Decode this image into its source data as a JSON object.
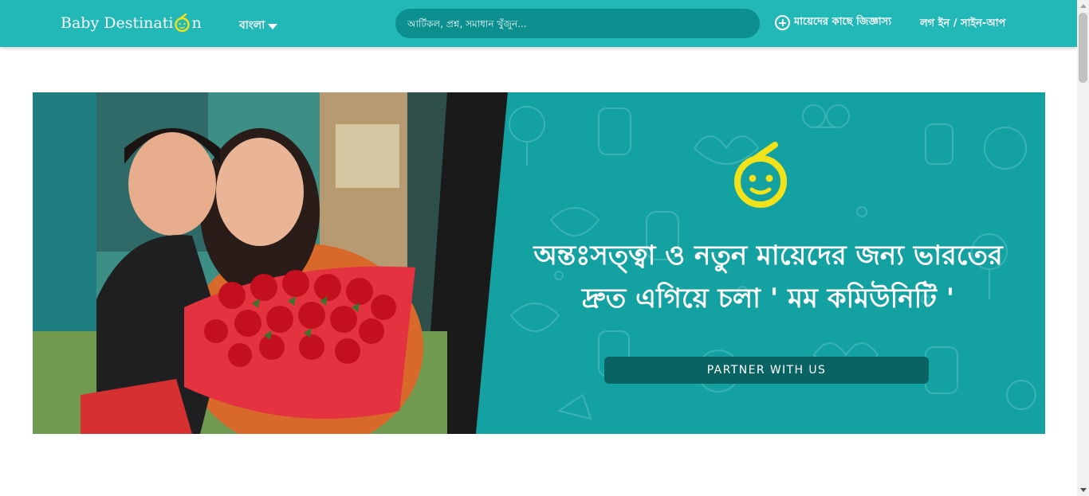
{
  "header": {
    "logo_text_prefix": "Baby Destinati",
    "logo_text_suffix": "n",
    "logo_icon": "baby-face-icon",
    "language_label": "বাংলা",
    "search_placeholder": "আর্টিকল, প্রশ্ন, সমাধান খুঁজুন...",
    "ask_label": "মায়েদের কাছে জিজ্ঞাস্য",
    "login_label": "লগ ইন / সাইন-আপ"
  },
  "banner": {
    "headline_line1": "অন্তঃসত্ত্বা ও নতুন মায়েদের জন্য ভারতের",
    "headline_line2": "দ্রুত এগিয়ে চলা ' মম কমিউনিটি '",
    "cta_label": "PARTNER WITH US"
  },
  "colors": {
    "header_bg": "#22b8b8",
    "search_bg": "#0e8f8f",
    "banner_bg": "#14a1a2",
    "button_bg": "#0a6363",
    "logo_accent": "#f2e21a"
  }
}
